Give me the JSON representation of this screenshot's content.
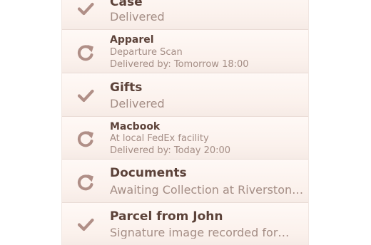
{
  "colors": {
    "title": "#5c4239",
    "subtitle": "#a48d85",
    "icon": "#b08f87",
    "row_bg": "#fbf1ec",
    "separator": "#e9dbd5"
  },
  "shipments": [
    {
      "title": "Case",
      "status_icon": "checkmark-icon",
      "lines": [
        "Delivered"
      ]
    },
    {
      "title": "Apparel",
      "status_icon": "refresh-icon",
      "lines": [
        "Departure Scan",
        "Delivered by: Tomorrow 18:00"
      ]
    },
    {
      "title": "Gifts",
      "status_icon": "checkmark-icon",
      "lines": [
        "Delivered"
      ]
    },
    {
      "title": "Macbook",
      "status_icon": "refresh-icon",
      "lines": [
        "At local FedEx facility",
        "Delivered by: Today 20:00"
      ]
    },
    {
      "title": "Documents",
      "status_icon": "refresh-icon",
      "lines": [
        "Awaiting Collection at Riverston…"
      ]
    },
    {
      "title": "Parcel from John",
      "status_icon": "checkmark-icon",
      "lines": [
        "Signature image recorded for…"
      ]
    }
  ]
}
